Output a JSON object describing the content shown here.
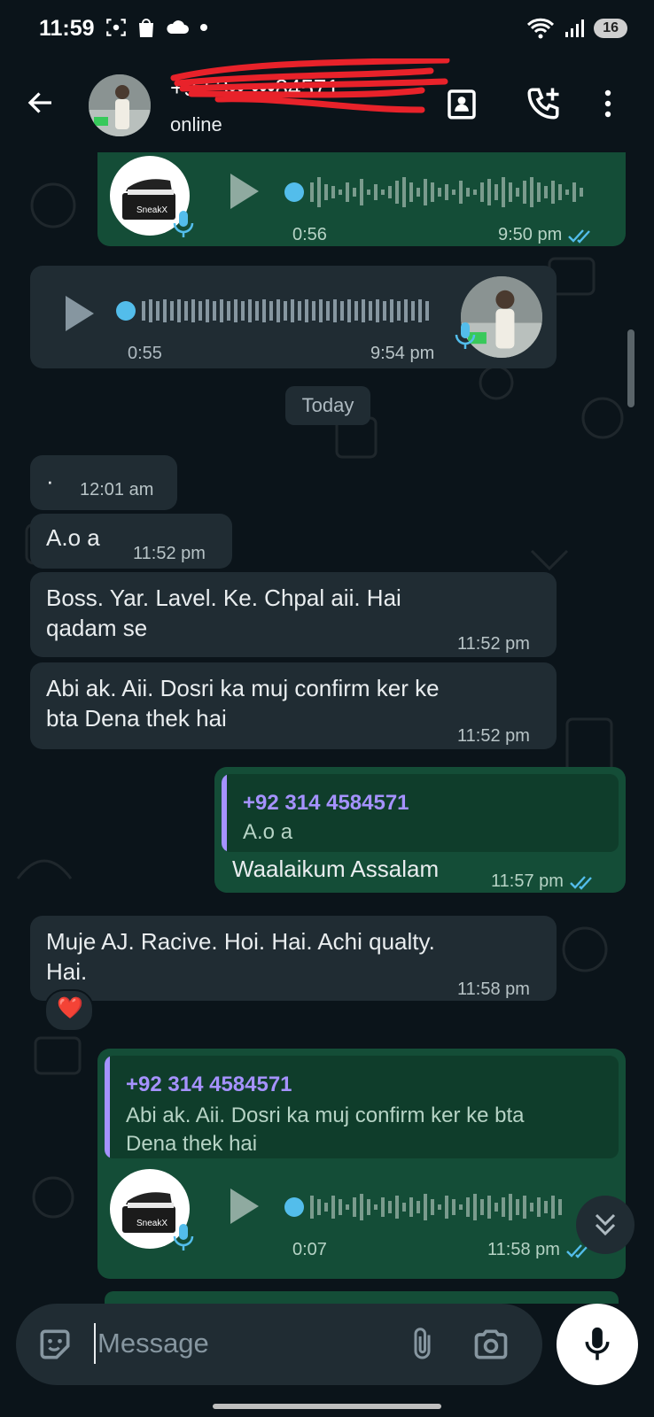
{
  "status_bar": {
    "time": "11:59",
    "battery": "16"
  },
  "header": {
    "contact_name": "+92 3•• •••84571",
    "status": "online"
  },
  "chat": {
    "date_divider": "Today",
    "messages": [
      {
        "id": "voice1",
        "direction": "out",
        "duration": "0:56",
        "time": "9:50 pm",
        "read": true
      },
      {
        "id": "voice2",
        "direction": "in",
        "duration": "0:55",
        "time": "9:54 pm"
      },
      {
        "id": "dot",
        "direction": "in",
        "text": "·",
        "time": "12:01 am"
      },
      {
        "id": "aoa",
        "direction": "in",
        "text": "A.o a",
        "time": "11:52 pm"
      },
      {
        "id": "boss",
        "direction": "in",
        "text_line1": "Boss. Yar. Lavel. Ke. Chpal aii. Hai",
        "text_line2": "qadam se",
        "time": "11:52 pm"
      },
      {
        "id": "abi",
        "direction": "in",
        "text_line1": "Abi ak. Aii. Dosri ka muj confirm ker ke",
        "text_line2": "bta Dena thek hai",
        "time": "11:52 pm"
      },
      {
        "id": "reply1",
        "direction": "out",
        "quote_name": "+92 314 4584571",
        "quote_text": "A.o a",
        "text": "Waalaikum Assalam",
        "time": "11:57 pm",
        "read": true
      },
      {
        "id": "muje",
        "direction": "in",
        "text_line1": "Muje AJ. Racive. Hoi. Hai. Achi qualty.",
        "text_line2": "Hai.",
        "time": "11:58 pm",
        "reaction": "❤️"
      },
      {
        "id": "reply2",
        "direction": "out",
        "quote_name": "+92 314 4584571",
        "quote_line1": "Abi ak. Aii. Dosri ka muj confirm ker ke bta",
        "quote_line2": "Dena thek hai",
        "duration": "0:07",
        "time": "11:58 pm",
        "read": true
      }
    ]
  },
  "composer": {
    "placeholder": "Message"
  },
  "colors": {
    "out_bubble": "#144d37",
    "in_bubble": "#202c33",
    "read_tick": "#53bdeb",
    "voice_dot": "#53bdeb"
  }
}
